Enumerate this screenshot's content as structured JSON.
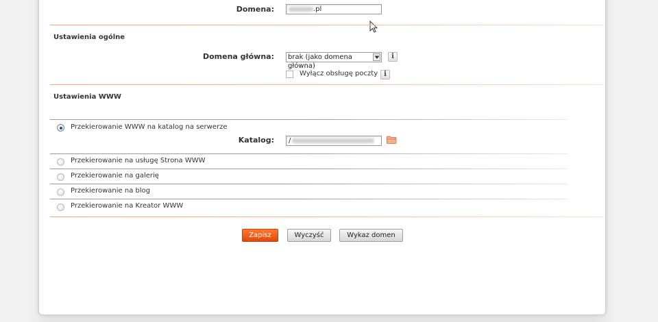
{
  "domain_section": {
    "label": "Domena:",
    "value_suffix": ".pl"
  },
  "general_settings": {
    "title": "Ustawienia ogólne",
    "main_domain_label": "Domena główna:",
    "main_domain_value": "brak (jako domena główna)",
    "info_glyph": "i",
    "disable_mail_label": "Wyłącz obsługę poczty"
  },
  "www_settings": {
    "title": "Ustawienia WWW",
    "options": [
      {
        "label": "Przekierowanie WWW na katalog na serwerze",
        "selected": true
      },
      {
        "label": "Przekierowanie na usługę Strona WWW",
        "selected": false
      },
      {
        "label": "Przekierowanie na galerię",
        "selected": false
      },
      {
        "label": "Przekierowanie na blog",
        "selected": false
      },
      {
        "label": "Przekierowanie na Kreator WWW",
        "selected": false
      }
    ],
    "directory_label": "Katalog:",
    "directory_value_prefix": "/"
  },
  "actions": {
    "save_label": "Zapisz",
    "clear_label": "Wyczyść",
    "domain_list_label": "Wykaz domen"
  },
  "colors": {
    "accent_orange": "#f36b1c",
    "divider_orange": "#f5b89a",
    "radio_selected": "#2a4f7a",
    "folder_icon": "#e8a07a"
  },
  "icons": {
    "cursor": "mouse-pointer-icon",
    "folder": "folder-icon",
    "info": "info-icon",
    "dropdown": "chevron-down-icon"
  }
}
